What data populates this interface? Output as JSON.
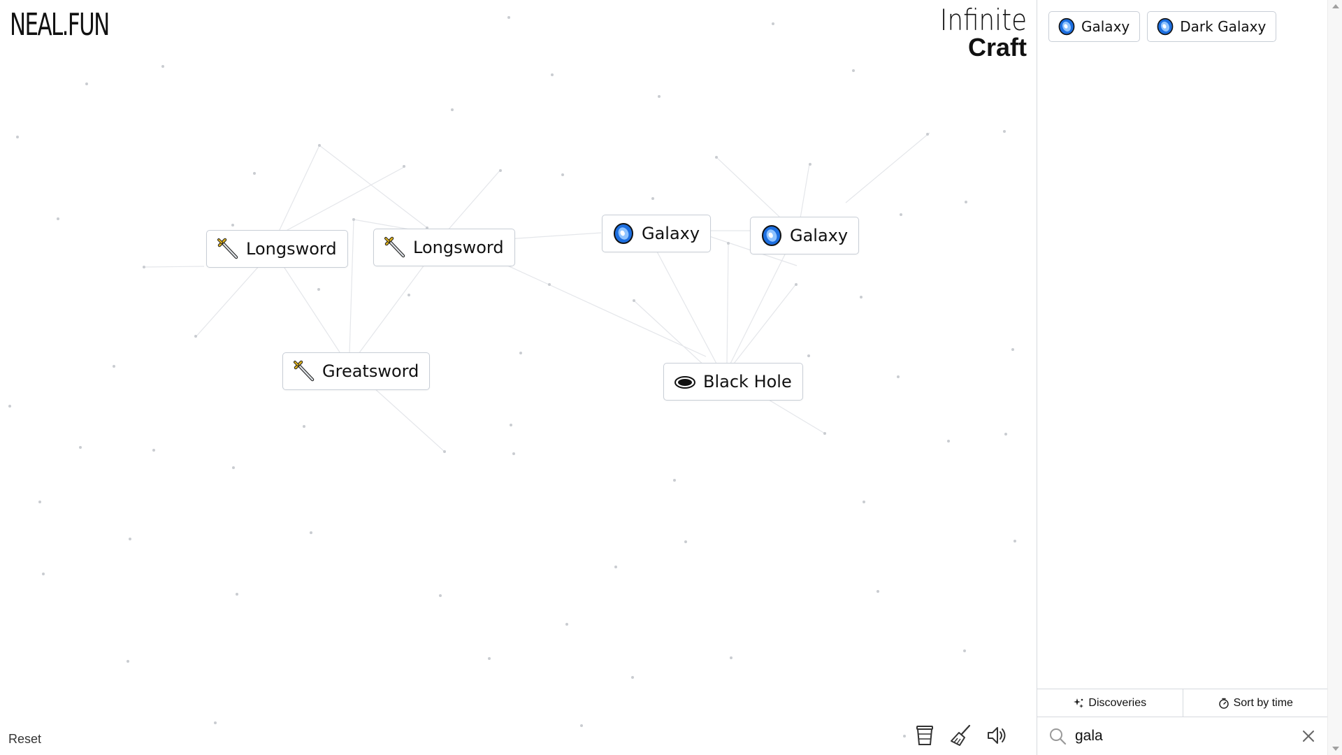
{
  "header": {
    "site_logo": "NEAL.FUN",
    "app_title_line1": "Infinite",
    "app_title_line2": "Craft"
  },
  "canvas": {
    "items": [
      {
        "label": "Longsword",
        "icon": "sword-icon"
      },
      {
        "label": "Longsword",
        "icon": "sword-icon"
      },
      {
        "label": "Galaxy",
        "icon": "galaxy-icon"
      },
      {
        "label": "Galaxy",
        "icon": "galaxy-icon"
      },
      {
        "label": "Greatsword",
        "icon": "sword-icon"
      },
      {
        "label": "Black Hole",
        "icon": "black-hole-icon"
      }
    ],
    "reset_label": "Reset",
    "tools": [
      "coffee-cup-icon",
      "broom-icon",
      "speaker-icon"
    ]
  },
  "sidebar": {
    "items": [
      {
        "label": "Galaxy",
        "icon": "galaxy-icon"
      },
      {
        "label": "Dark Galaxy",
        "icon": "galaxy-icon"
      }
    ],
    "tabs": [
      {
        "label": "Discoveries",
        "icon": "sparkle-icon"
      },
      {
        "label": "Sort by time",
        "icon": "clock-icon"
      }
    ],
    "search": {
      "value": "gala",
      "icon": "search-icon"
    }
  },
  "colors": {
    "border": "#c8ced6",
    "galaxy_blue": "#1d6fe0",
    "sword_gold": "#e0b21a"
  }
}
